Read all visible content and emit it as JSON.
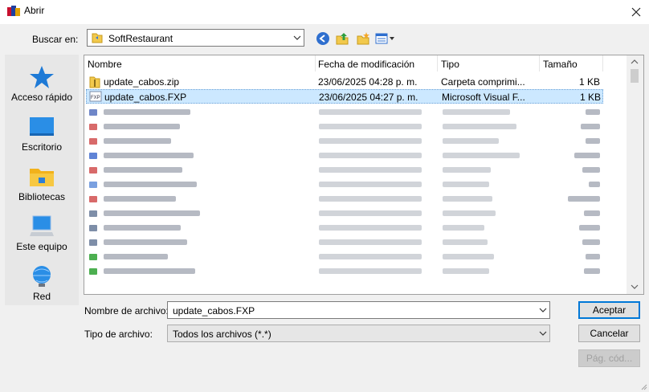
{
  "window": {
    "title": "Abrir"
  },
  "lookin": {
    "label": "Buscar en:",
    "value": "SoftRestaurant"
  },
  "places": [
    {
      "label": "Acceso rápido",
      "icon": "star-icon"
    },
    {
      "label": "Escritorio",
      "icon": "desktop-icon"
    },
    {
      "label": "Bibliotecas",
      "icon": "libraries-icon"
    },
    {
      "label": "Este equipo",
      "icon": "computer-icon"
    },
    {
      "label": "Red",
      "icon": "network-icon"
    }
  ],
  "columns": {
    "name": "Nombre",
    "date": "Fecha de modificación",
    "type": "Tipo",
    "size": "Tamaño"
  },
  "files": [
    {
      "name": "update_cabos.zip",
      "date": "23/06/2025 04:28 p. m.",
      "type": "Carpeta comprimi...",
      "size": "1 KB",
      "icon": "zip-folder-icon"
    },
    {
      "name": "update_cabos.FXP",
      "date": "23/06/2025 04:27 p. m.",
      "type": "Microsoft Visual F...",
      "size": "1 KB",
      "icon": "fxp-file-icon",
      "selected": true
    }
  ],
  "blurred_rows": 12,
  "filename": {
    "label": "Nombre de archivo:",
    "value": "update_cabos.FXP"
  },
  "filetype": {
    "label": "Tipo de archivo:",
    "value": "Todos los archivos (*.*)"
  },
  "buttons": {
    "open": "Aceptar",
    "cancel": "Cancelar",
    "codepage": "Pág. cód..."
  }
}
